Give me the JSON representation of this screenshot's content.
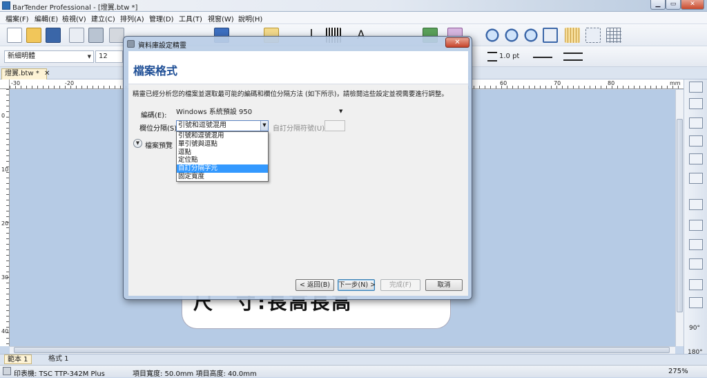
{
  "window": {
    "title": "BarTender Professional - [燈翼.btw *]",
    "controls": {
      "minimize": "▁",
      "maximize": "▭",
      "close": "✕"
    }
  },
  "menu": [
    "檔案(F)",
    "編輯(E)",
    "檢視(V)",
    "建立(C)",
    "排列(A)",
    "管理(D)",
    "工具(T)",
    "視窗(W)",
    "說明(H)"
  ],
  "toolbar2": {
    "font_name": "新細明體",
    "font_size": "12",
    "line_width": "1.0 pt"
  },
  "document_tab": {
    "label": "燈翼.btw *",
    "close": "✕"
  },
  "ruler": {
    "top_labels": [
      "-30",
      "-20",
      "60",
      "70",
      "80",
      "mm"
    ],
    "left_labels": [
      "0",
      "10",
      "20",
      "30",
      "40"
    ]
  },
  "canvas": {
    "label_text": "尺　寸:長高長高"
  },
  "right_tools": {
    "rotate_90": "90°",
    "rotate_180": "180°"
  },
  "bottom_tabs": [
    "範本 1",
    "格式 1"
  ],
  "status": {
    "printer": "印表機: TSC TTP-342M Plus",
    "item_size": "項目寬度: 50.0mm  項目高度: 40.0mm",
    "zoom": "275%"
  },
  "dialog": {
    "title": "資料庫設定精靈",
    "close": "✕",
    "heading": "檔案格式",
    "description": "精靈已經分析您的檔案並選取最可能的編碼和欄位分隔方法 (如下所示)，請檢閱這些設定並視需要進行調整。",
    "encoding_label": "編碼(E):",
    "encoding_value": "Windows 系統預設 950",
    "delimiter_label": "欄位分隔(S):",
    "delimiter_value": "引號和逗號混用",
    "custom_delimiter_label": "自訂分隔符號(U):",
    "custom_delimiter_value": "",
    "delimiter_options": [
      "引號和逗號混用",
      "單引號與逗點",
      "逗點",
      "定位點",
      "自訂分隔字元",
      "固定寬度"
    ],
    "selected_option_index": 4,
    "preview_label": "檔案預覽",
    "buttons": {
      "back": "< 返回(B)",
      "next": "下一步(N) >",
      "finish": "完成(F)",
      "cancel": "取消"
    }
  }
}
